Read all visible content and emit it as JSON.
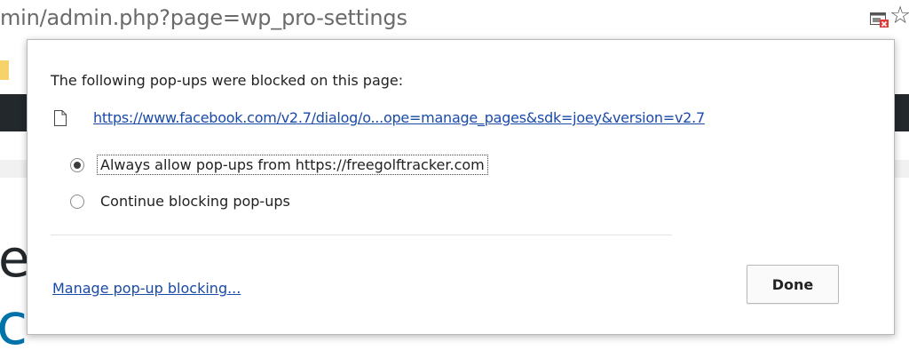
{
  "address_bar": {
    "url": "min/admin.php?page=wp_pro-settings"
  },
  "toolbar_icons": {
    "popup_blocked": "popup-blocked-icon",
    "bookmark": "star-icon",
    "bookmark_glyph": "☆"
  },
  "dialog": {
    "title": "The following pop-ups were blocked on this page:",
    "blocked_items": [
      {
        "icon": "page-icon",
        "url": "https://www.facebook.com/v2.7/dialog/o...ope=manage_pages&sdk=joey&version=v2.7"
      }
    ],
    "options": [
      {
        "label": "Always allow pop-ups from https://freegolftracker.com",
        "selected": true
      },
      {
        "label": "Continue blocking pop-ups",
        "selected": false
      }
    ],
    "manage_link": "Manage pop-up blocking...",
    "done_label": "Done"
  },
  "colors": {
    "link": "#1a4aa8",
    "admin_bar": "#23282d",
    "accent_blue": "#0073aa"
  }
}
